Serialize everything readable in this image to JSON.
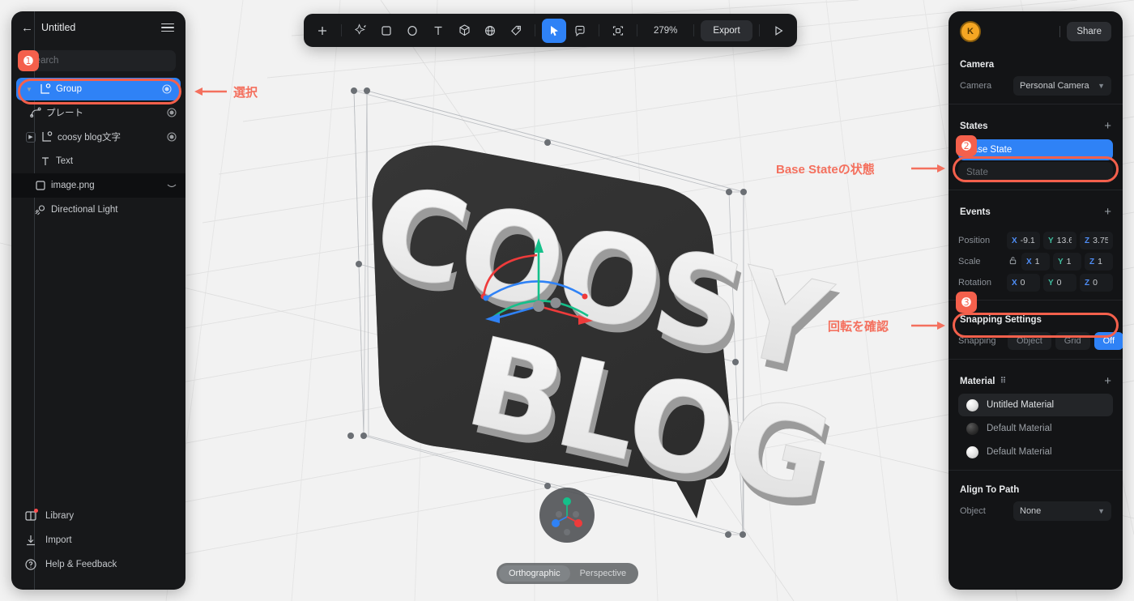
{
  "app": {
    "document_title": "Untitled",
    "back_icon": "back-arrow-icon",
    "menu_icon": "hamburger-menu-icon"
  },
  "layers_panel": {
    "search_placeholder": "Search",
    "items": [
      {
        "label": "Group",
        "icon": "group-node-icon",
        "depth": 0,
        "selected": true,
        "twisty": "chevron-down",
        "eye": true
      },
      {
        "label": "プレート",
        "icon": "path-node-icon",
        "depth": 1,
        "selected": false,
        "twisty": "none",
        "eye": true
      },
      {
        "label": "coosy blog文字",
        "icon": "group-node-icon",
        "depth": 1,
        "selected": false,
        "twisty": "chevron-right-boxed",
        "eye": true
      },
      {
        "label": "Text",
        "icon": "text-node-icon",
        "depth": 2,
        "selected": false,
        "twisty": "none",
        "eye": false
      },
      {
        "label": "image.png",
        "icon": "image-node-icon",
        "depth": 0,
        "selected": false,
        "twisty": "none",
        "eye": false
      },
      {
        "label": "Directional Light",
        "icon": "directional-light-icon",
        "depth": 0,
        "selected": false,
        "twisty": "none",
        "eye": false
      }
    ],
    "footer": [
      {
        "label": "Library",
        "icon": "library-icon",
        "badge": true
      },
      {
        "label": "Import",
        "icon": "import-icon",
        "badge": false
      },
      {
        "label": "Help & Feedback",
        "icon": "help-icon",
        "badge": false
      }
    ]
  },
  "toolbar": {
    "add_label": "+",
    "zoom_level": "279%",
    "export_label": "Export",
    "tools": [
      {
        "name": "magic-wand-icon",
        "active": false
      },
      {
        "name": "rectangle-icon",
        "active": false
      },
      {
        "name": "ellipse-icon",
        "active": false
      },
      {
        "name": "text-tool-icon",
        "active": false
      },
      {
        "name": "cube-icon",
        "active": false
      },
      {
        "name": "sphere-icon",
        "active": false
      },
      {
        "name": "tag-icon",
        "active": false
      },
      {
        "name": "cursor-icon",
        "active": true
      },
      {
        "name": "comment-icon",
        "active": false
      },
      {
        "name": "frame-icon",
        "active": false
      }
    ],
    "play_icon": "play-icon"
  },
  "properties_panel": {
    "avatar_initial": "K",
    "share_label": "Share",
    "camera": {
      "section_title": "Camera",
      "row_label": "Camera",
      "value": "Personal Camera"
    },
    "states": {
      "section_title": "States",
      "add_icon": "plus-icon",
      "items": [
        {
          "label": "Base State",
          "selected": true
        },
        {
          "label": "State",
          "selected": false
        }
      ]
    },
    "events": {
      "section_title": "Events",
      "add_icon": "plus-icon"
    },
    "transform": {
      "position": {
        "label": "Position",
        "x": "-9.10",
        "y": "13.64",
        "z": "3.75"
      },
      "scale": {
        "label": "Scale",
        "x": "1",
        "y": "1",
        "z": "1",
        "lock_icon": "unlock-icon"
      },
      "rotation": {
        "label": "Rotation",
        "x": "0",
        "y": "0",
        "z": "0"
      },
      "axis_x": "X",
      "axis_y": "Y",
      "axis_z": "Z"
    },
    "snapping": {
      "section_title": "Snapping Settings",
      "row_label": "Snapping",
      "options": [
        {
          "label": "Object",
          "on": false
        },
        {
          "label": "Grid",
          "on": false
        },
        {
          "label": "Off",
          "on": true
        }
      ]
    },
    "material": {
      "section_title": "Material",
      "expand_icon": "expand-corners-icon",
      "add_icon": "plus-icon",
      "items": [
        {
          "label": "Untitled Material",
          "swatch": "white",
          "selected": true
        },
        {
          "label": "Default Material",
          "swatch": "dark",
          "selected": false
        },
        {
          "label": "Default Material",
          "swatch": "white",
          "selected": false
        }
      ]
    },
    "align_to_path": {
      "section_title": "Align To Path",
      "row_label": "Object",
      "value": "None"
    }
  },
  "viewport": {
    "logo_line1": "COOSY",
    "logo_line2": "BLOG",
    "gizmo_icon": "axis-gizmo-icon",
    "projection": [
      {
        "label": "Orthographic",
        "on": true
      },
      {
        "label": "Perspective",
        "on": false
      }
    ]
  },
  "annotations": {
    "accent_color": "#f4604c",
    "items": [
      {
        "badge": "❶",
        "text": "選択"
      },
      {
        "badge": "❷",
        "text": "Base Stateの状態"
      },
      {
        "badge": "❸",
        "text": "回転を確認"
      }
    ]
  }
}
